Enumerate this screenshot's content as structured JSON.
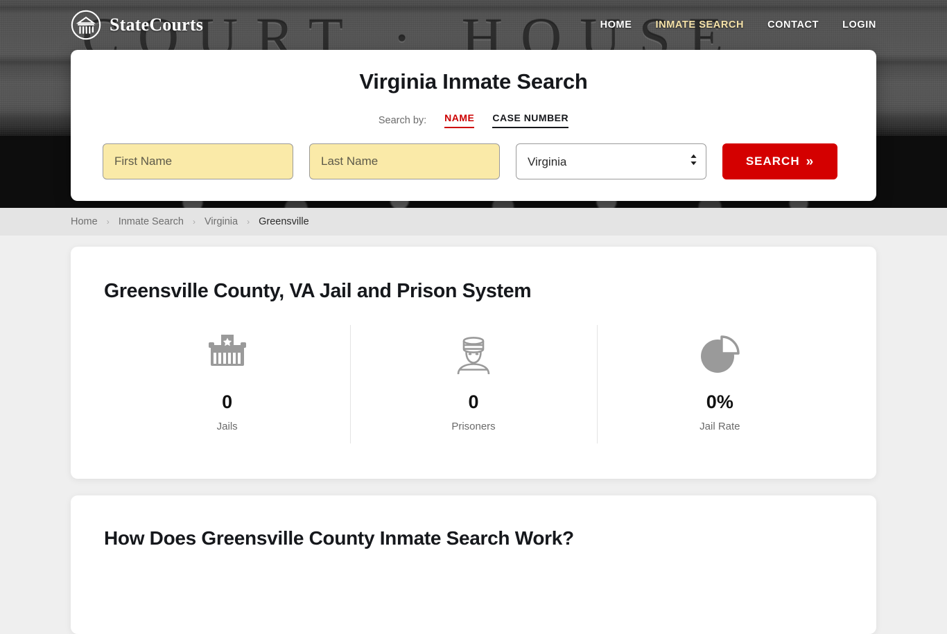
{
  "brand": {
    "name": "StateCourts",
    "logo_icon": "courthouse-circle-icon"
  },
  "nav": {
    "items": [
      {
        "label": "HOME",
        "active": false
      },
      {
        "label": "INMATE SEARCH",
        "active": true
      },
      {
        "label": "CONTACT",
        "active": false
      },
      {
        "label": "LOGIN",
        "active": false
      }
    ],
    "active_color": "#f5e2a8",
    "inactive_color": "#ffffff"
  },
  "search_card": {
    "title": "Virginia Inmate Search",
    "search_by_label": "Search by:",
    "tabs": [
      {
        "label": "NAME",
        "active": true,
        "color": "#cc0000"
      },
      {
        "label": "CASE NUMBER",
        "active": false,
        "color": "#16181c"
      }
    ],
    "first_name": {
      "value": "",
      "placeholder": "First Name"
    },
    "last_name": {
      "value": "",
      "placeholder": "Last Name"
    },
    "state": {
      "selected": "Virginia",
      "options": [
        "Virginia"
      ]
    },
    "submit": {
      "label": "SEARCH",
      "chevron": "»",
      "color": "#d40000"
    },
    "field_fill_color": "#faeaa8"
  },
  "breadcrumb": {
    "separator": "›",
    "items": [
      {
        "label": "Home",
        "current": false
      },
      {
        "label": "Inmate Search",
        "current": false
      },
      {
        "label": "Virginia",
        "current": false
      },
      {
        "label": "Greensville",
        "current": true
      }
    ]
  },
  "main": {
    "page_title": "Greensville County, VA Jail and Prison System",
    "stats": [
      {
        "icon": "jail-building-icon",
        "value": "0",
        "label": "Jails"
      },
      {
        "icon": "prisoner-icon",
        "value": "0",
        "label": "Prisoners"
      },
      {
        "icon": "pie-chart-icon",
        "value": "0%",
        "label": "Jail Rate"
      }
    ],
    "next_section_title": "How Does Greensville County Inmate Search Work?"
  },
  "background": {
    "engraved_text": "COURT · HOUSE"
  }
}
